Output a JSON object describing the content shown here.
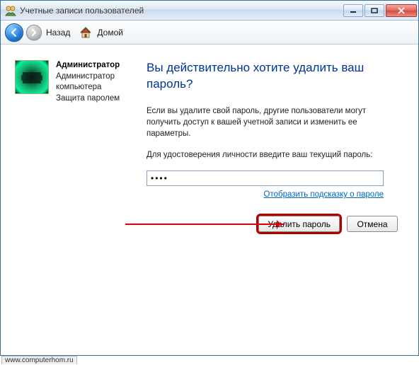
{
  "window": {
    "title": "Учетные записи пользователей"
  },
  "nav": {
    "back_label": "Назад",
    "home_label": "Домой"
  },
  "account": {
    "name": "Администратор",
    "role": "Администратор компьютера",
    "status": "Защита паролем"
  },
  "main": {
    "heading": "Вы действительно хотите удалить ваш пароль?",
    "warning": "Если вы удалите свой пароль, другие пользователи могут получить доступ к вашей учетной записи и изменить ее параметры.",
    "prompt": "Для удостоверения личности введите ваш текущий пароль:",
    "password_value": "••••",
    "hint_link": "Отобразить подсказку о пароле",
    "delete_button": "Удалить пароль",
    "cancel_button": "Отмена"
  },
  "watermark": "www.computerhom.ru"
}
